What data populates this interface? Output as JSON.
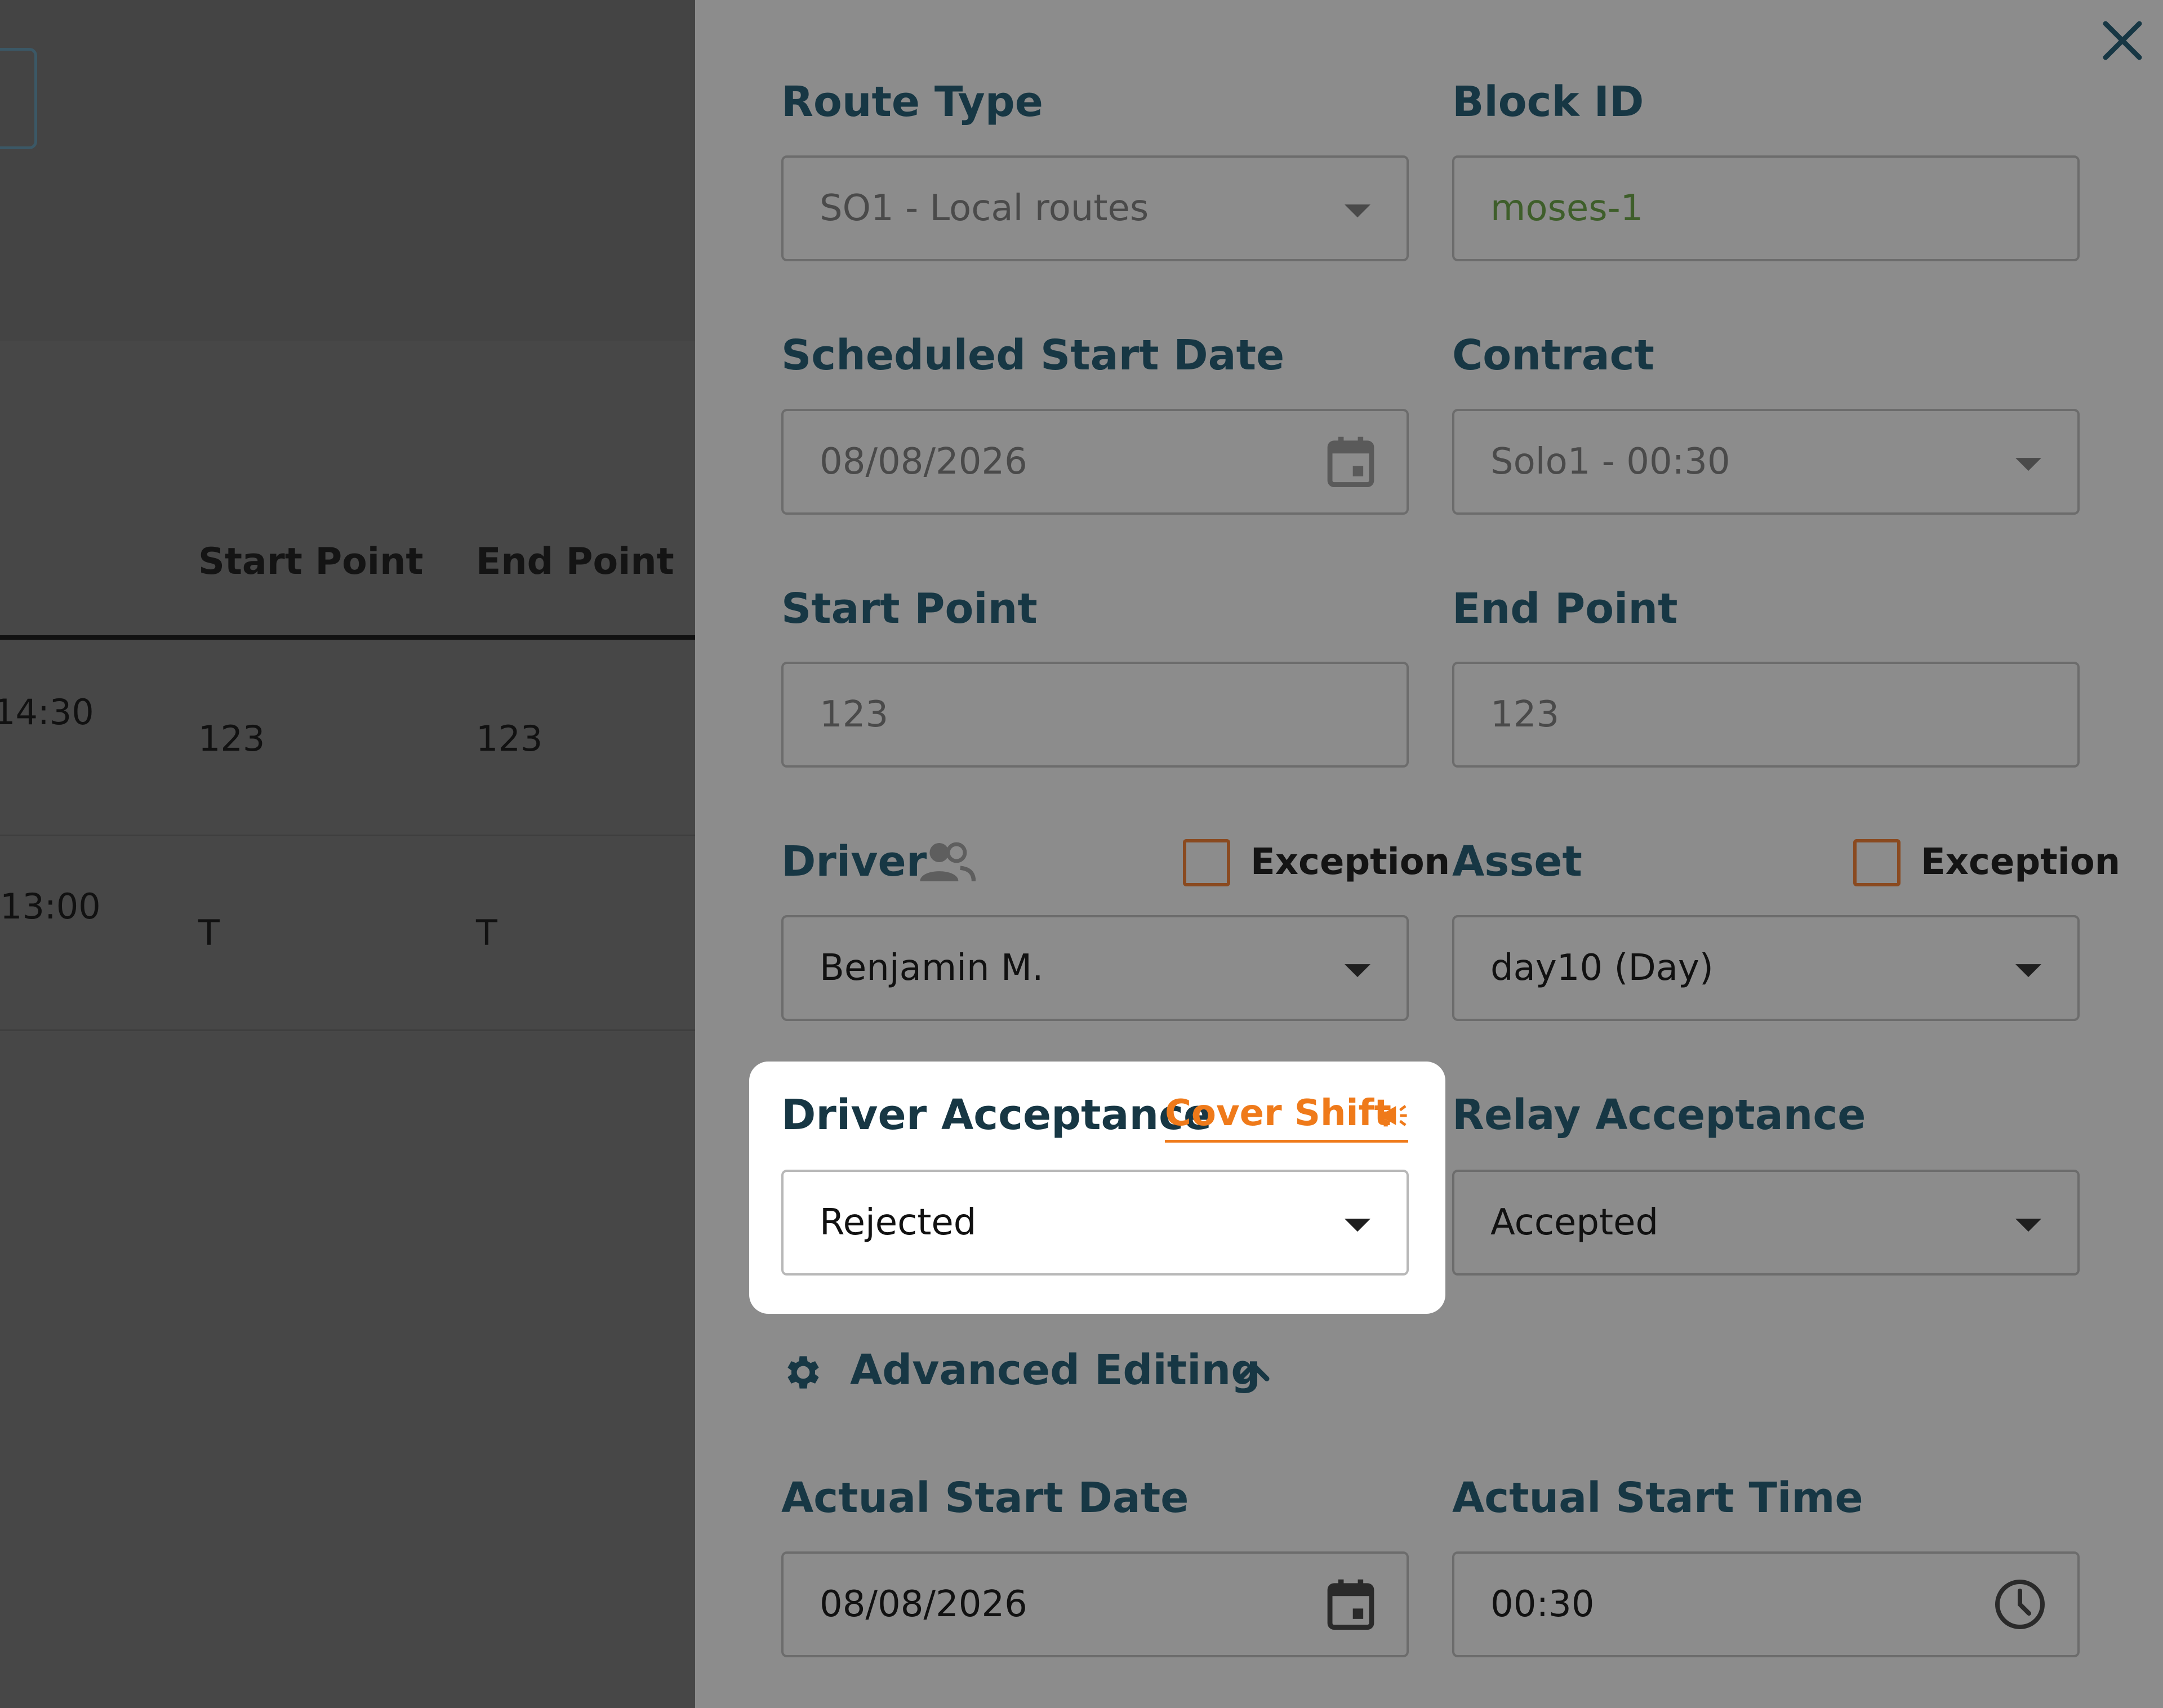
{
  "background_table": {
    "headers": {
      "start_point": "Start Point",
      "end_point": "End Point"
    },
    "rows": [
      {
        "time": "14:30",
        "start_point": "123",
        "end_point": "123"
      },
      {
        "time": "13:00",
        "start_point": "T",
        "end_point": "T"
      }
    ]
  },
  "form": {
    "route_type": {
      "label": "Route Type",
      "value": "SO1 - Local routes"
    },
    "block_id": {
      "label": "Block ID",
      "value": "moses-1"
    },
    "scheduled_start_date": {
      "label": "Scheduled Start Date",
      "value": "08/08/2026"
    },
    "contract": {
      "label": "Contract",
      "value": "Solo1 - 00:30"
    },
    "start_point": {
      "label": "Start Point",
      "value": "123"
    },
    "end_point": {
      "label": "End Point",
      "value": "123"
    },
    "driver": {
      "label": "Driver",
      "value": "Benjamin M.",
      "exception_label": "Exception"
    },
    "asset": {
      "label": "Asset",
      "value": "day10 (Day)",
      "exception_label": "Exception"
    },
    "driver_acceptance": {
      "label": "Driver Acceptance",
      "value": "Rejected",
      "cover_shift_label": "Cover Shift"
    },
    "relay_acceptance": {
      "label": "Relay Acceptance",
      "value": "Accepted"
    },
    "advanced_editing": {
      "label": "Advanced Editing"
    },
    "actual_start_date": {
      "label": "Actual Start Date",
      "value": "08/08/2026"
    },
    "actual_start_time": {
      "label": "Actual Start Time",
      "value": "00:30"
    }
  },
  "icons": {
    "close": "close-icon",
    "calendar": "calendar-icon",
    "people": "people-icon",
    "megaphone": "megaphone-icon",
    "gear": "gear-icon",
    "chevron_up": "chevron-up-icon",
    "clock": "clock-icon"
  },
  "colors": {
    "label": "#173744",
    "accent_orange": "#ef7a1a",
    "checkbox_border": "#8a4a20",
    "overlay_panel": "#8c8c8c",
    "highlight_bg": "#ffffff"
  }
}
